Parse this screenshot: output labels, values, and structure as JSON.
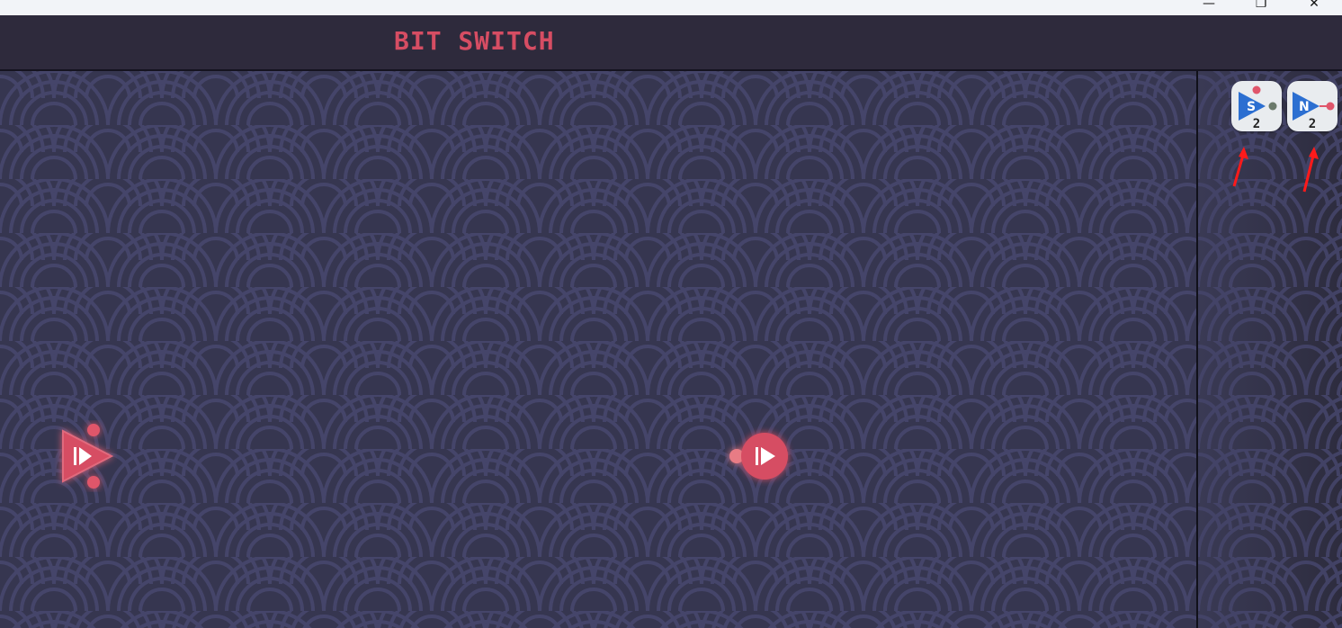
{
  "window": {
    "minimize_icon": "minimize-icon",
    "maximize_icon": "restore-icon",
    "close_icon": "close-icon",
    "minimize_glyph": "—",
    "maximize_glyph": "❐",
    "close_glyph": "✕"
  },
  "header": {
    "title": "BIT SWITCH"
  },
  "palette": {
    "tools": [
      {
        "letter": "S",
        "count": "2",
        "icon": "switch-tool-icon"
      },
      {
        "letter": "N",
        "count": "2",
        "icon": "not-tool-icon"
      }
    ]
  },
  "canvas": {
    "nodes": [
      {
        "kind": "source",
        "icon": "play-triangle-icon"
      },
      {
        "kind": "sink",
        "icon": "play-circle-icon"
      }
    ]
  },
  "colors": {
    "accent": "#d64d63",
    "background": "#363650",
    "header_bg": "#2e2a3c",
    "wave_line": "#45456a",
    "tool_blue": "#2c6fd1",
    "tool_bg": "#e9ecef",
    "annotation_red": "#ff1a1a"
  }
}
